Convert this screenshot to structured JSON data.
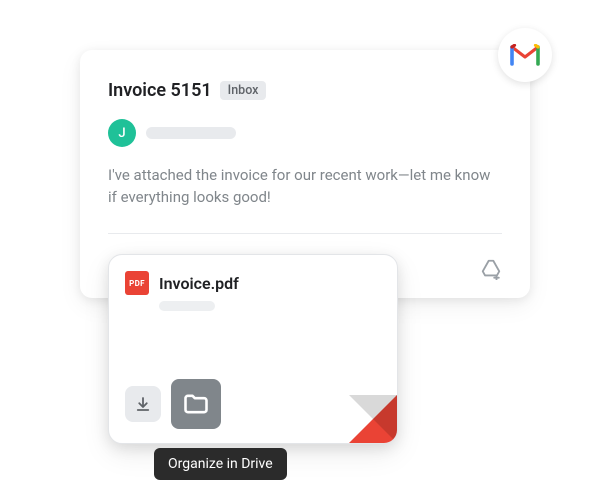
{
  "email": {
    "subject": "Invoice 5151",
    "label": "Inbox",
    "avatar_initial": "J",
    "body": "I've attached the invoice for our recent work—let me know if everything looks good!"
  },
  "attachment": {
    "badge": "PDF",
    "filename": "Invoice.pdf"
  },
  "tooltip": "Organize in Drive"
}
